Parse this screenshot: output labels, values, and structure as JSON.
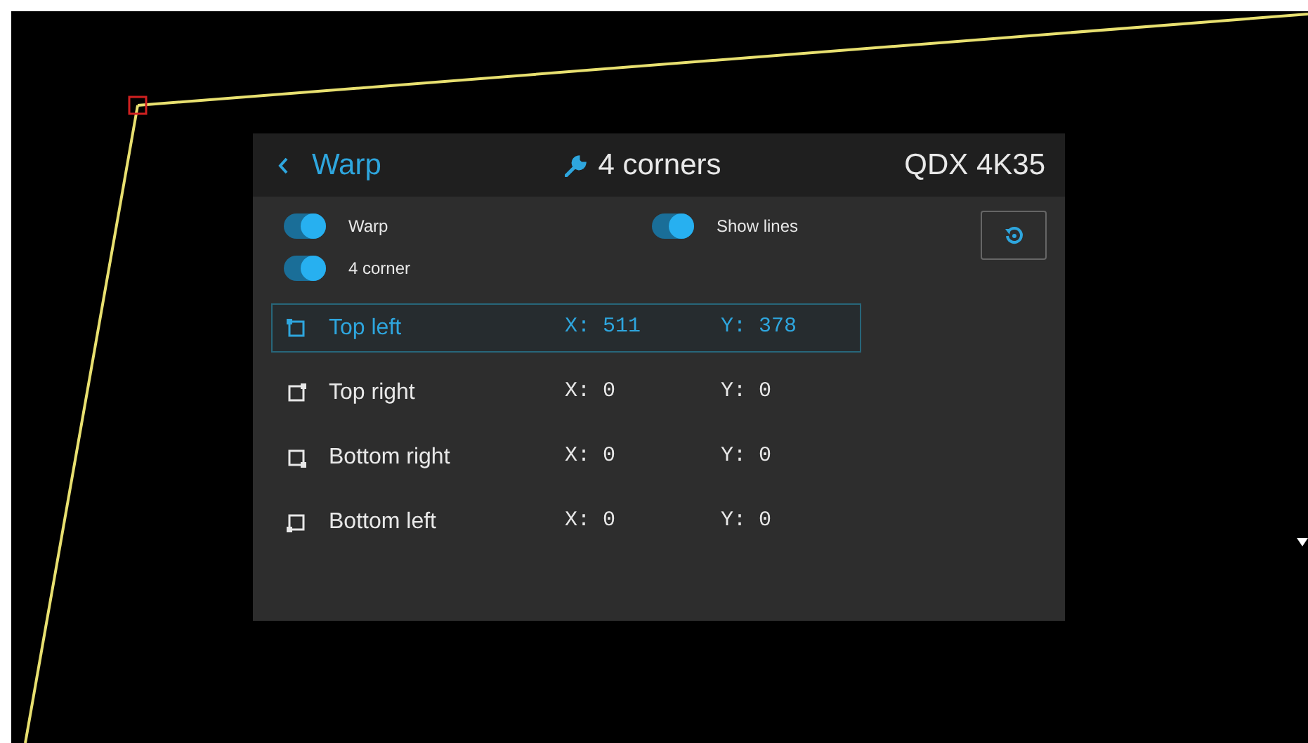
{
  "header": {
    "back_label": "Warp",
    "title": "4 corners",
    "model": "QDX 4K35"
  },
  "toggles": [
    {
      "label": "Warp",
      "on": true
    },
    {
      "label": "Show lines",
      "on": true
    },
    {
      "label": "4 corner",
      "on": true
    }
  ],
  "corners": [
    {
      "kind": "top-left",
      "name": "Top left",
      "x": "X: 511",
      "y": "Y: 378",
      "selected": true
    },
    {
      "kind": "top-right",
      "name": "Top right",
      "x": "X: 0",
      "y": "Y: 0",
      "selected": false
    },
    {
      "kind": "bottom-right",
      "name": "Bottom right",
      "x": "X: 0",
      "y": "Y: 0",
      "selected": false
    },
    {
      "kind": "bottom-left",
      "name": "Bottom left",
      "x": "X: 0",
      "y": "Y: 0",
      "selected": false
    }
  ]
}
